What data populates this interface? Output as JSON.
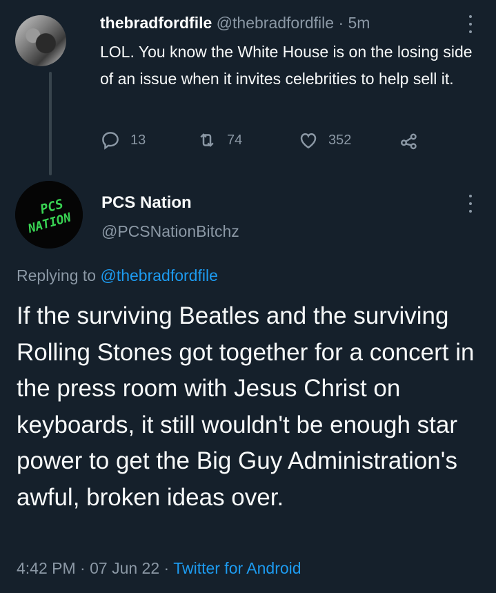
{
  "tweet1": {
    "name": "thebradfordfile",
    "handle": "@thebradfordfile",
    "separator": "·",
    "time": "5m",
    "text": "LOL. You know the White House is on the losing side of an issue when it invites celebrities to help sell it.",
    "replies": "13",
    "retweets": "74",
    "likes": "352",
    "icons": {
      "reply": "reply-icon",
      "retweet": "retweet-icon",
      "like": "heart-icon",
      "share": "share-icon",
      "more": "more-icon"
    }
  },
  "tweet2": {
    "name": "PCS Nation",
    "handle": "@PCSNationBitchz",
    "avatar_text_top": "PCS",
    "avatar_text_bottom": "NATION",
    "avatar_color": "#39d353",
    "replying_prefix": "Replying to",
    "replying_handle": "@thebradfordfile",
    "text": "If the surviving Beatles and the surviving Rolling Stones got together for a concert in the press room with Jesus Christ on keyboards, it still wouldn't be enough star power to get the Big Guy Administration's awful, broken ideas over.",
    "time": "4:42 PM",
    "separator": "·",
    "date": "07 Jun 22",
    "separator2": "·",
    "source": "Twitter for Android"
  },
  "colors": {
    "background": "#15202b",
    "accent": "#1d9bf0",
    "secondary_text": "#8b98a5"
  }
}
